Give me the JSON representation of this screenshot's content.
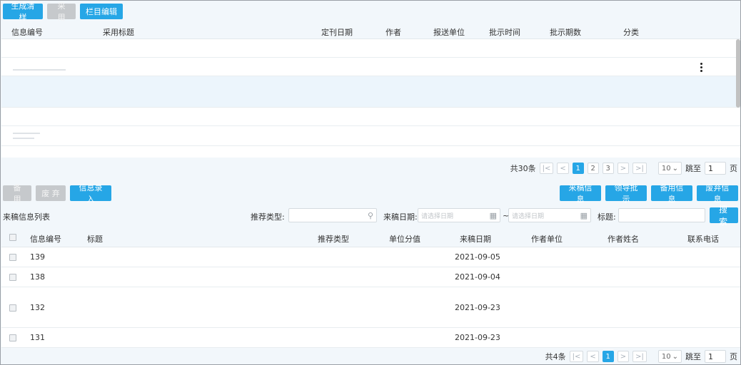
{
  "top_toolbar": {
    "generate_label": "生成清样",
    "adopt_label": "采 用",
    "column_edit_label": "栏目编辑"
  },
  "top_table": {
    "columns": [
      "信息编号",
      "采用标题",
      "定刊日期",
      "作者",
      "报送单位",
      "批示时间",
      "批示期数",
      "分类"
    ]
  },
  "top_pager": {
    "total": "共30条",
    "pages": [
      "1",
      "2",
      "3"
    ],
    "active_page": "1",
    "page_size": "10",
    "jump_label": "跳至",
    "jump_value": "1",
    "page_suffix": "页"
  },
  "mid_toolbar": {
    "reserve_label": "备 用",
    "discard_label": "废 弃",
    "entry_label": "信息录入",
    "submitted_label": "来稿信息",
    "leader_label": "领导批示",
    "reserve_info_label": "备用信息",
    "discarded_info_label": "废弃信息"
  },
  "filters": {
    "list_title": "来稿信息列表",
    "recommend_type_label": "推荐类型:",
    "date_label": "来稿日期:",
    "date_start_placeholder": "请选择日期",
    "date_sep": "~",
    "date_end_placeholder": "请选择日期",
    "title_label": "标题:",
    "search_label": "搜 索"
  },
  "bottom_table": {
    "columns": [
      "信息编号",
      "标题",
      "推荐类型",
      "单位分值",
      "来稿日期",
      "作者单位",
      "作者姓名",
      "联系电话"
    ],
    "rows": [
      {
        "id": "139",
        "date": "2021-09-05"
      },
      {
        "id": "138",
        "date": "2021-09-04"
      },
      {
        "id": "132",
        "date": "2021-09-23"
      },
      {
        "id": "131",
        "date": "2021-09-23"
      }
    ]
  },
  "bottom_pager": {
    "total": "共4条",
    "active_page": "1",
    "page_size": "10",
    "jump_label": "跳至",
    "jump_value": "1",
    "page_suffix": "页"
  },
  "colors": {
    "primary": "#26a6e6",
    "disabled": "#c6c9cc",
    "header_bg": "#f2f7fb",
    "row_highlight": "#ecf5fc"
  }
}
